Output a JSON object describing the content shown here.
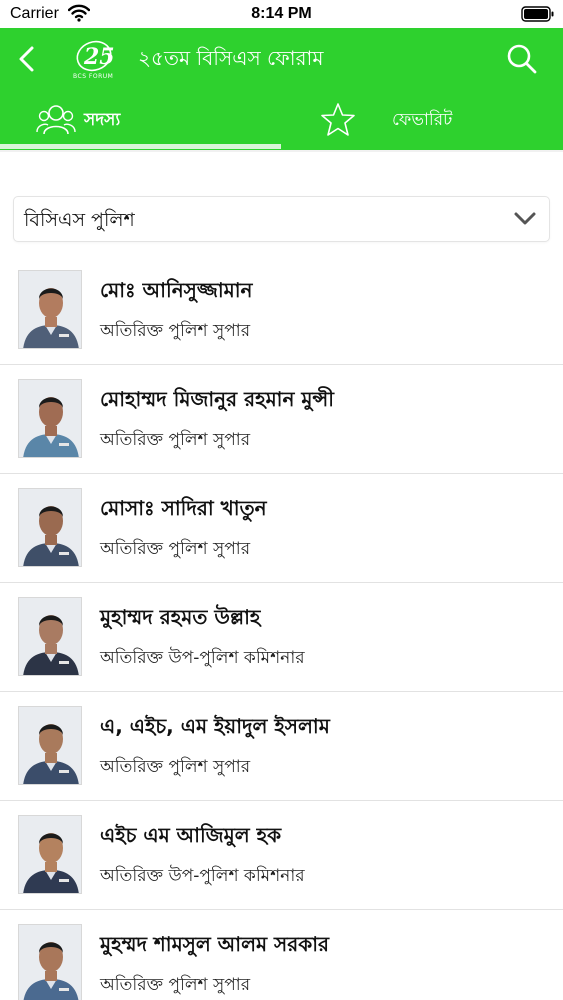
{
  "status_bar": {
    "carrier": "Carrier",
    "time": "8:14 PM"
  },
  "header": {
    "title": "২৫তম বিসিএস ফোরাম",
    "logo_number": "25",
    "logo_text": "BCS FORUM",
    "back_icon": "chevron-left-icon",
    "search_icon": "search-icon",
    "background_color": "#2ed12e"
  },
  "tabs": [
    {
      "label": "সদস্য",
      "icon": "members-icon",
      "active": true
    },
    {
      "label": "ফেভারিট",
      "icon": "star-icon",
      "active": false
    }
  ],
  "filter": {
    "selected": "বিসিএস পুলিশ",
    "icon": "chevron-down-icon"
  },
  "members": [
    {
      "name": "মোঃ আনিসুজ্জামান",
      "designation": "অতিরিক্ত পুলিশ সুপার",
      "uniform_color": "#4f5f78",
      "skin_color": "#b27c5f"
    },
    {
      "name": "মোহাম্মদ মিজানুর রহমান মুন্সী",
      "designation": "অতিরিক্ত পুলিশ সুপার",
      "uniform_color": "#5a86a8",
      "skin_color": "#a06c53"
    },
    {
      "name": "মোসাঃ সাদিরা খাতুন",
      "designation": "অতিরিক্ত পুলিশ সুপার",
      "uniform_color": "#3f4f68",
      "skin_color": "#9a6a50"
    },
    {
      "name": "মুহাম্মদ রহমত উল্লাহ",
      "designation": "অতিরিক্ত উপ-পুলিশ কমিশনার",
      "uniform_color": "#2c3446",
      "skin_color": "#a97b62"
    },
    {
      "name": "এ, এইচ, এম ইয়াদুল ইসলাম",
      "designation": "অতিরিক্ত পুলিশ সুপার",
      "uniform_color": "#3b4d6a",
      "skin_color": "#a97a5c"
    },
    {
      "name": "এইচ এম আজিমুল হক",
      "designation": "অতিরিক্ত উপ-পুলিশ কমিশনার",
      "uniform_color": "#2f3a52",
      "skin_color": "#b4825f"
    },
    {
      "name": "মুহম্মদ শামসুল আলম সরকার",
      "designation": "অতিরিক্ত পুলিশ সুপার",
      "uniform_color": "#4b6a90",
      "skin_color": "#a9775a"
    }
  ]
}
